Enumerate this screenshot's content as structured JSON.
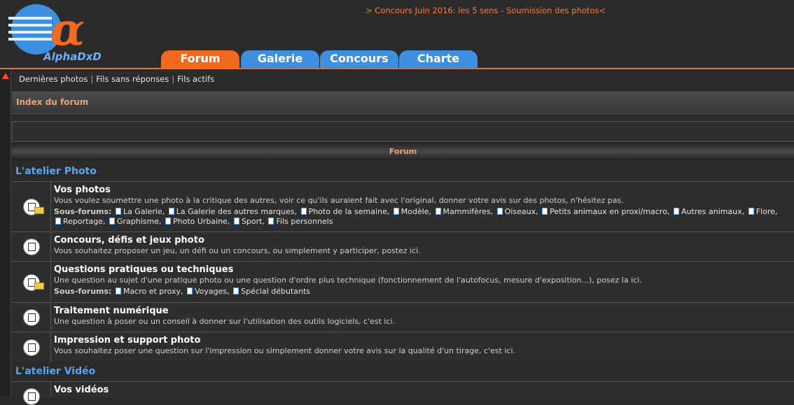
{
  "header": {
    "logo_text": "AlphaDxD",
    "promo": "> Concours Juin 2016: les 5 sens - Soumission des photos<",
    "tabs": [
      "Forum",
      "Galerie",
      "Concours",
      "Charte"
    ]
  },
  "nav": {
    "links": [
      "Dernières photos",
      "Fils sans réponses",
      "Fils actifs"
    ]
  },
  "index_title": "Index du forum",
  "forum_column": "Forum",
  "categories": [
    {
      "name": "L'atelier Photo"
    },
    {
      "name": "L'atelier Vidéo"
    }
  ],
  "forums": [
    {
      "title": "Vos photos",
      "desc": "Vous voulez soumettre une photo à la critique des autres, voir ce qu'ils auraient fait avec l'original, donner votre avis sur des photos, n'hésitez pas.",
      "sub_label": "Sous-forums:",
      "subforums_line1": [
        "La Galerie",
        "La Galerie des autres marques",
        "Photo de la semaine",
        "Modèle",
        "Mammifères",
        "Oiseaux",
        "Petits animaux en proxi/macro",
        "Autres animaux",
        "Flore"
      ],
      "subforums_line2": [
        "Reportage",
        "Graphisme",
        "Photo Urbaine",
        "Sport",
        "Fils personnels"
      ]
    },
    {
      "title": "Concours, défis et jeux photo",
      "desc": "Vous souhaitez proposer un jeu, un défi ou un concours, ou simplement y participer, postez ici."
    },
    {
      "title": "Questions pratiques ou techniques",
      "desc": "Une question au sujet d'une pratique photo ou une question d'ordre plus technique (fonctionnement de l'autofocus, mesure d'exposition...), posez la ici.",
      "sub_label": "Sous-forums:",
      "subforums_line1": [
        "Macro et proxy",
        "Voyages",
        "Spécial débutants"
      ]
    },
    {
      "title": "Traitement numérique",
      "desc": "Une question à poser ou un conseil à donner sur l'utilisation des outils logiciels, c'est ici."
    },
    {
      "title": "Impression et support photo",
      "desc": "Vous souhaitez poser une question sur l'impression ou simplement donner votre avis sur la qualité d'un tirage, c'est ici."
    },
    {
      "title": "Vos vidéos"
    }
  ]
}
